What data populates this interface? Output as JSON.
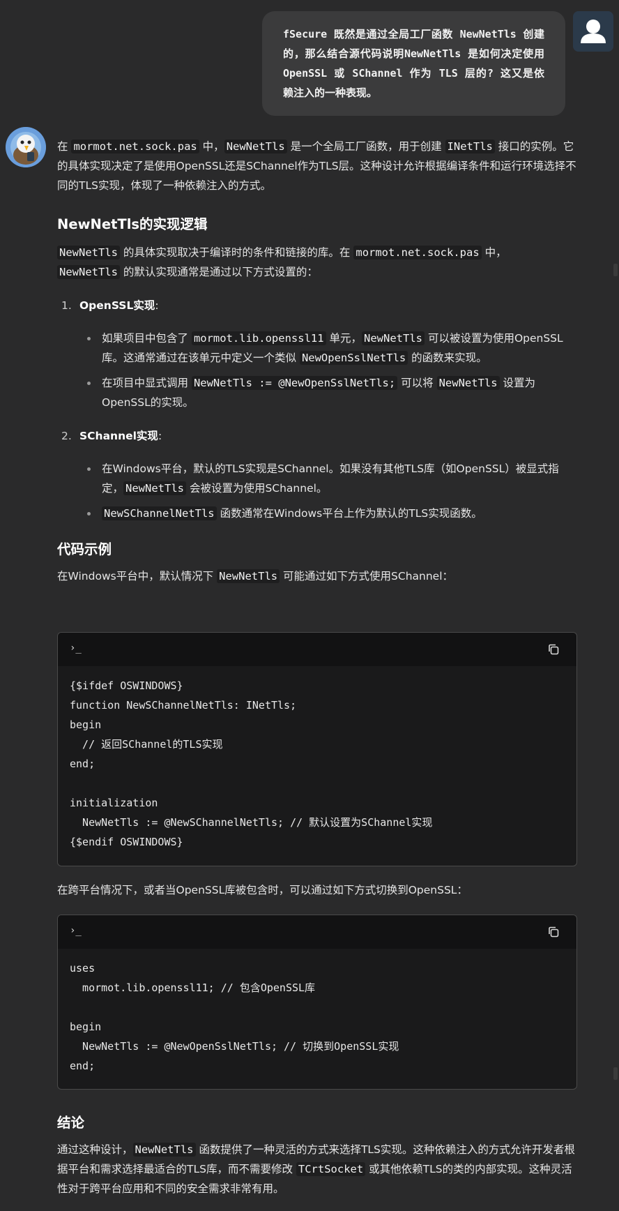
{
  "user_message": {
    "text": "fSecure 既然是通过全局工厂函数 NewNetTls 创建的，那么结合源代码说明NewNetTls 是如何决定使用 OpenSSL 或 SChannel 作为 TLS 层的? 这又是依赖注入的一种表现。"
  },
  "icons": {
    "user_avatar": "user-icon",
    "bot_avatar": "eagle-avatar",
    "code_prompt": "terminal-icon",
    "copy": "copy-icon"
  },
  "answer": {
    "intro": {
      "p1": "在 ",
      "c1": "mormot.net.sock.pas",
      "p2": " 中，",
      "c2": "NewNetTls",
      "p3": " 是一个全局工厂函数，用于创建 ",
      "c3": "INetTls",
      "p4": " 接口的实例。它的具体实现决定了是使用OpenSSL还是SChannel作为TLS层。这种设计允许根据编译条件和运行环境选择不同的TLS实现，体现了一种依赖注入的方式。"
    },
    "h_impl": "NewNetTls的实现逻辑",
    "impl_para": {
      "c1": "NewNetTls",
      "p1": " 的具体实现取决于编译时的条件和链接的库。在 ",
      "c2": "mormot.net.sock.pas",
      "p2": " 中，",
      "c3": "NewNetTls",
      "p3": " 的默认实现通常是通过以下方式设置的："
    },
    "item1": {
      "num": "1.",
      "title": "OpenSSL实现",
      "colon": ":",
      "b1_p1": "如果项目中包含了 ",
      "b1_c1": "mormot.lib.openssl11",
      "b1_p2": " 单元，",
      "b1_c2": "NewNetTls",
      "b1_p3": " 可以被设置为使用OpenSSL库。这通常通过在该单元中定义一个类似 ",
      "b1_c3": "NewOpenSslNetTls",
      "b1_p4": " 的函数来实现。",
      "b2_p1": "在项目中显式调用 ",
      "b2_c1": "NewNetTls := @NewOpenSslNetTls;",
      "b2_p2": " 可以将 ",
      "b2_c2": "NewNetTls",
      "b2_p3": " 设置为OpenSSL的实现。"
    },
    "item2": {
      "num": "2.",
      "title": "SChannel实现",
      "colon": ":",
      "b1_p1": "在Windows平台，默认的TLS实现是SChannel。如果没有其他TLS库（如OpenSSL）被显式指定，",
      "b1_c1": "NewNetTls",
      "b1_p2": " 会被设置为使用SChannel。",
      "b2_c1": "NewSChannelNetTls",
      "b2_p1": " 函数通常在Windows平台上作为默认的TLS实现函数。"
    },
    "h_code": "代码示例",
    "code_intro": {
      "p1": "在Windows平台中，默认情况下 ",
      "c1": "NewNetTls",
      "p2": " 可能通过如下方式使用SChannel："
    },
    "code1": {
      "prompt": "›_",
      "lines": "{$ifdef OSWINDOWS}\nfunction NewSChannelNetTls: INetTls;\nbegin\n  // 返回SChannel的TLS实现\nend;\n\ninitialization\n  NewNetTls := @NewSChannelNetTls; // 默认设置为SChannel实现\n{$endif OSWINDOWS}"
    },
    "cross_para": "在跨平台情况下，或者当OpenSSL库被包含时，可以通过如下方式切换到OpenSSL：",
    "code2": {
      "prompt": "›_",
      "lines": "uses\n  mormot.lib.openssl11; // 包含OpenSSL库\n\nbegin\n  NewNetTls := @NewOpenSslNetTls; // 切换到OpenSSL实现\nend;"
    },
    "h_conc": "结论",
    "conc": {
      "p1": "通过这种设计，",
      "c1": "NewNetTls",
      "p2": " 函数提供了一种灵活的方式来选择TLS实现。这种依赖注入的方式允许开发者根据平台和需求选择最适合的TLS库，而不需要修改 ",
      "c2": "TCrtSocket",
      "p3": " 或其他依赖TLS的类的内部实现。这种灵活性对于跨平台应用和不同的安全需求非常有用。"
    }
  }
}
